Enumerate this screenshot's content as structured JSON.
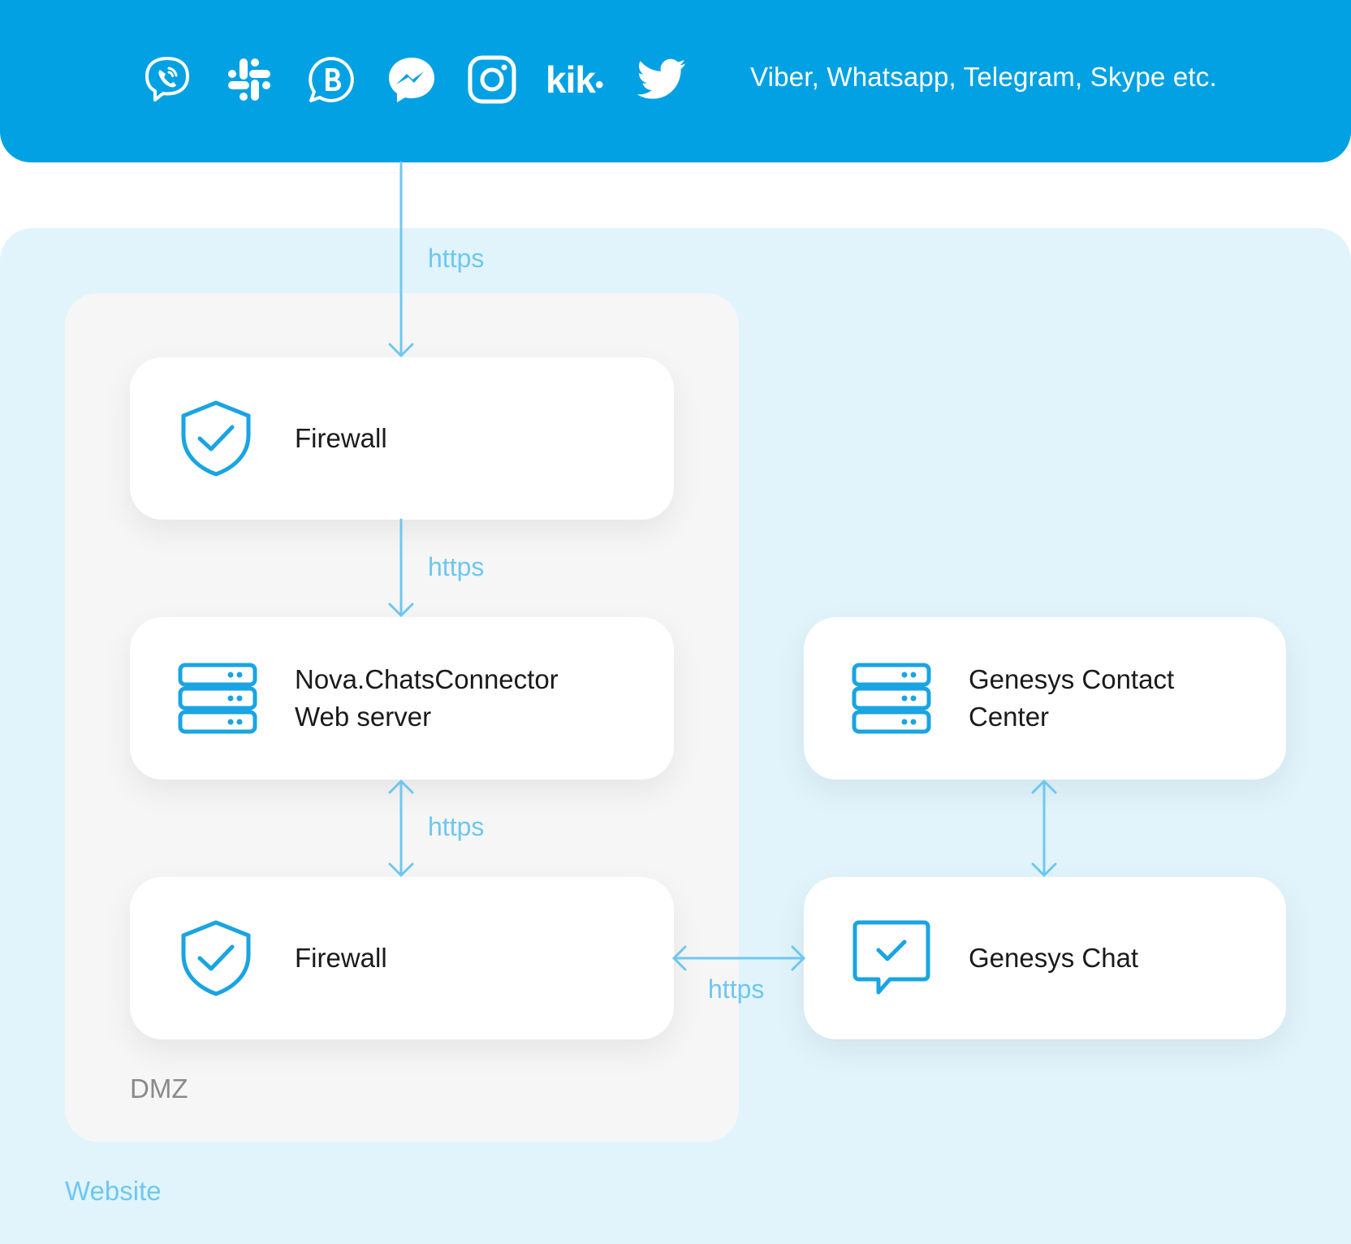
{
  "channels": {
    "icons": [
      "viber-icon",
      "slack-icon",
      "whatsapp-business-icon",
      "messenger-icon",
      "instagram-icon",
      "kik-icon",
      "twitter-icon"
    ],
    "kik_text": "kik",
    "text": "Viber, Whatsapp, Telegram, Skype etc."
  },
  "zones": {
    "website": "Website",
    "dmz": "DMZ"
  },
  "nodes": {
    "firewall_top": {
      "label": "Firewall",
      "icon": "shield-check-icon"
    },
    "web_server": {
      "label": "Nova.ChatsConnector\nWeb server",
      "icon": "server-icon"
    },
    "firewall_bottom": {
      "label": "Firewall",
      "icon": "shield-check-icon"
    },
    "contact_center": {
      "label": "Genesys Contact\nCenter",
      "icon": "server-icon"
    },
    "genesys_chat": {
      "label": "Genesys Chat",
      "icon": "chat-check-icon"
    }
  },
  "connections": {
    "channels_to_firewall": "https",
    "firewall_to_server": "https",
    "server_to_firewall": "https",
    "firewall_to_chat": "https"
  },
  "colors": {
    "brand_blue": "#02a1e3",
    "website_bg": "#e1f4fc",
    "dmz_bg": "#f6f6f6",
    "connector": "#6fc7ef",
    "icon_blue": "#1aa4e2"
  }
}
